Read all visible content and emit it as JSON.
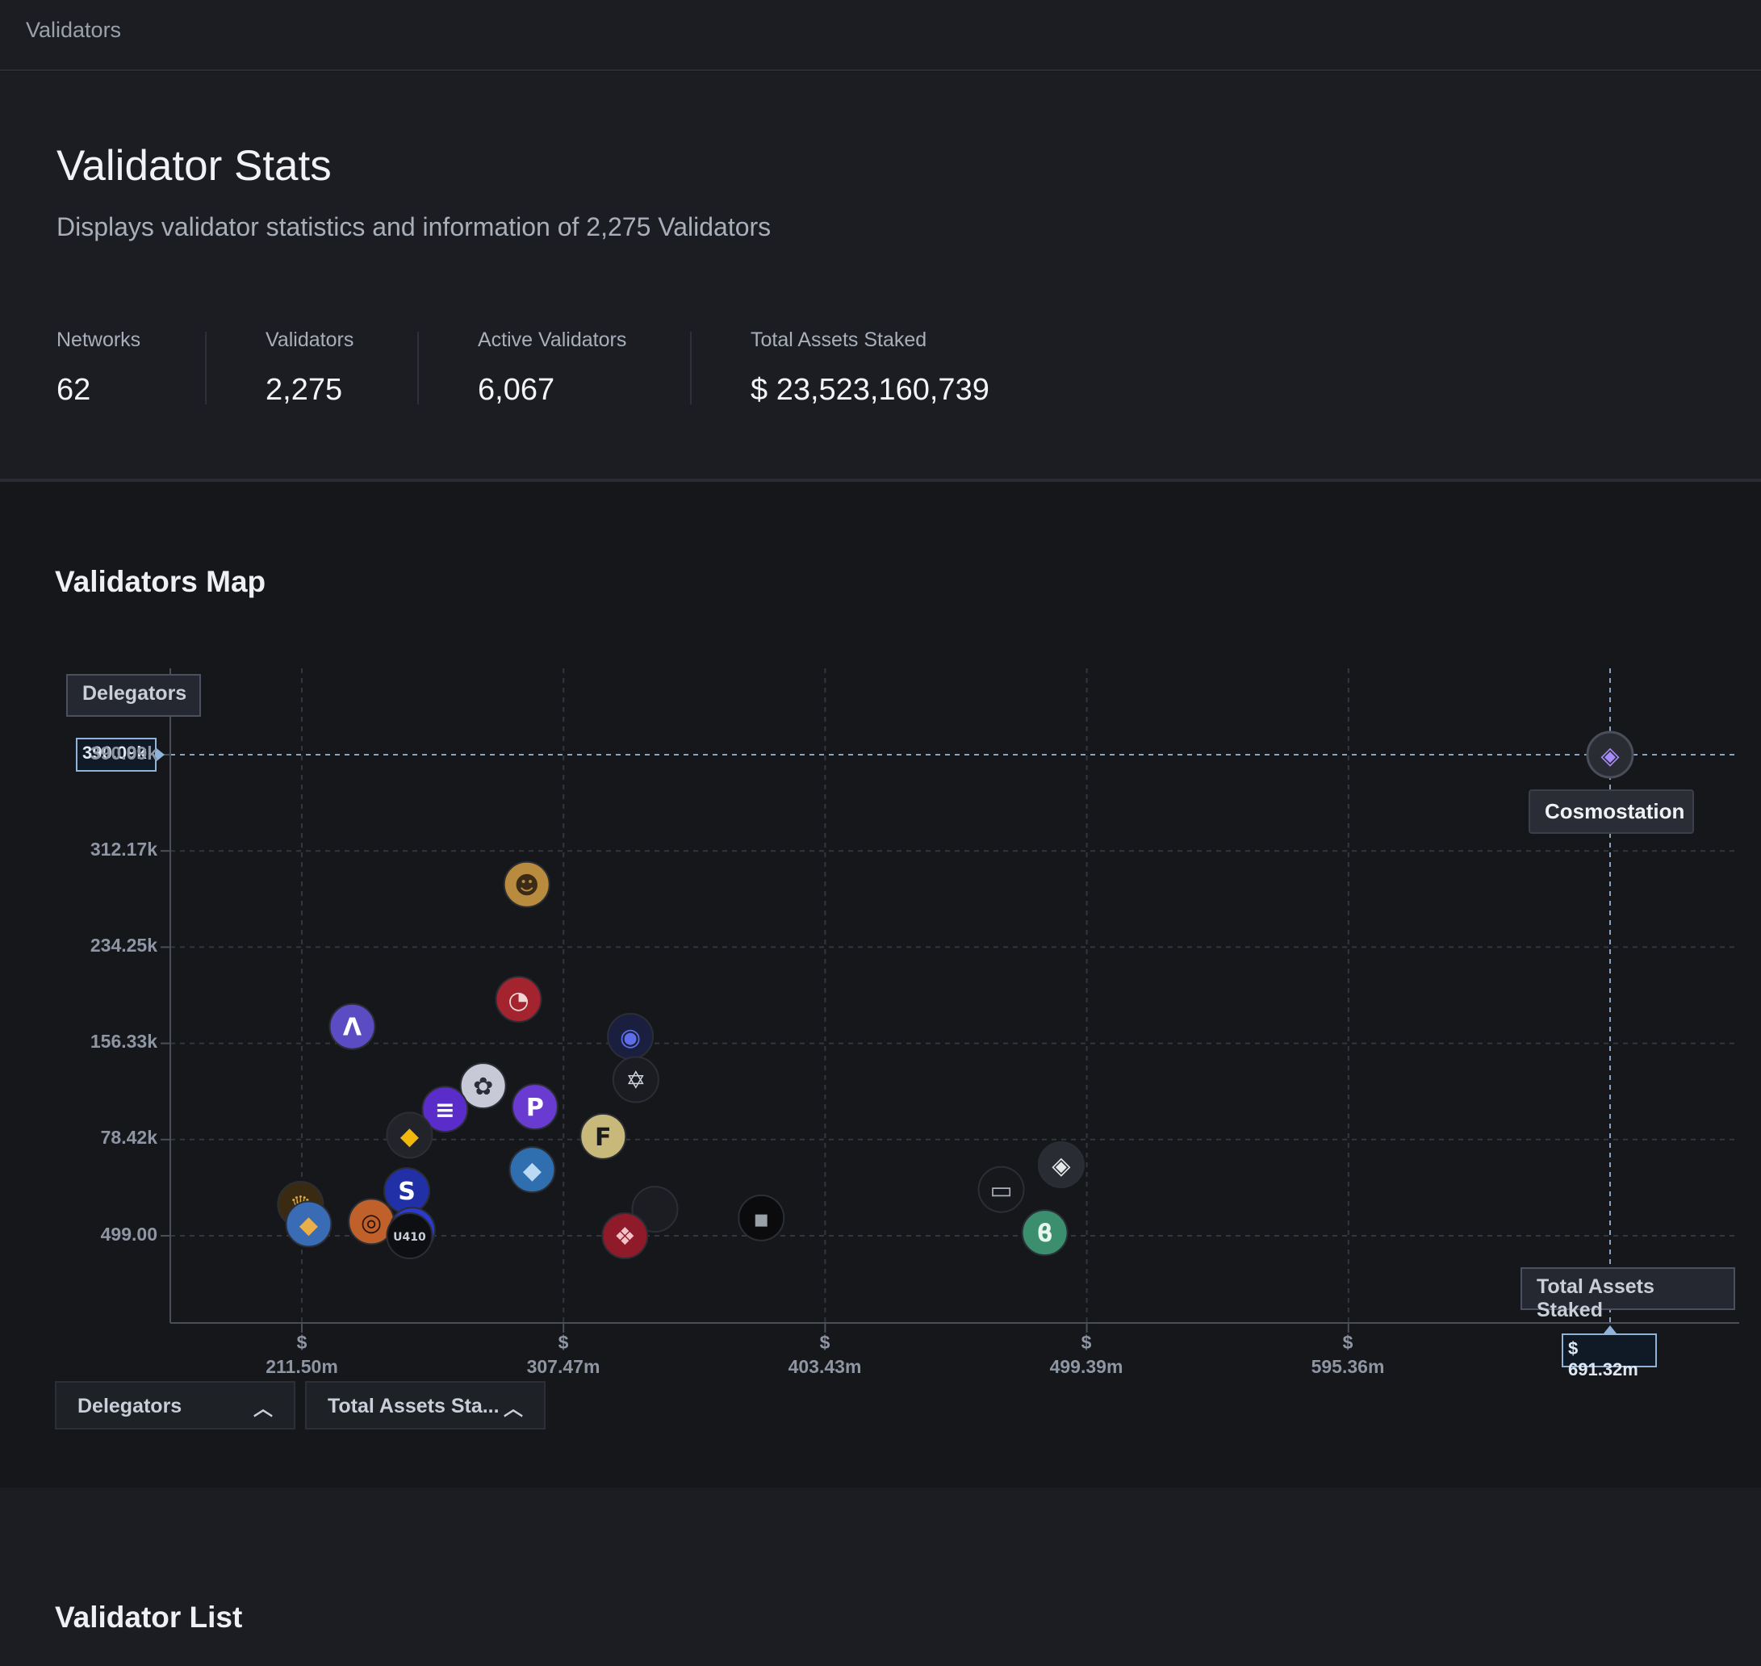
{
  "breadcrumb": "Validators",
  "header": {
    "title": "Validator Stats",
    "subtitle": "Displays validator statistics and information of 2,275 Validators"
  },
  "stats": [
    {
      "label": "Networks",
      "value": "62"
    },
    {
      "label": "Validators",
      "value": "2,275"
    },
    {
      "label": "Active Validators",
      "value": "6,067"
    },
    {
      "label": "Total Assets Staked",
      "value": "$ 23,523,160,739"
    }
  ],
  "map": {
    "title": "Validators Map",
    "y_axis_label": "Delegators",
    "x_axis_label": "Total Assets Staked",
    "y_ticks": [
      "390.09k",
      "312.17k",
      "234.25k",
      "156.33k",
      "78.42k",
      "499.00"
    ],
    "x_ticks": [
      {
        "top": "$",
        "bottom": "211.50m"
      },
      {
        "top": "$",
        "bottom": "307.47m"
      },
      {
        "top": "$",
        "bottom": "403.43m"
      },
      {
        "top": "$",
        "bottom": "499.39m"
      },
      {
        "top": "$",
        "bottom": "595.36m"
      }
    ],
    "hover": {
      "name": "Cosmostation",
      "y_value": "390.09k",
      "x_value": "$ 691.32m"
    },
    "dropdowns": [
      {
        "label": "Delegators",
        "icon": "chevron-up-icon"
      },
      {
        "label": "Total Assets Sta...",
        "icon": "chevron-up-icon"
      }
    ]
  },
  "list": {
    "title": "Validator List"
  },
  "chart_data": {
    "type": "scatter",
    "title": "Validators Map",
    "xlabel": "Total Assets Staked",
    "ylabel": "Delegators",
    "xlim": [
      163.5,
      720
    ],
    "ylim": [
      -70000,
      390090
    ],
    "points": [
      {
        "name": "Cosmostation",
        "x": 691.32,
        "y": 390090,
        "color": "#2a2c33",
        "mark": "◈",
        "fg": "#a78bfa"
      },
      {
        "x": 294,
        "y": 285000,
        "color": "#b98b3e",
        "mark": "☻",
        "fg": "#3a2a16"
      },
      {
        "x": 291,
        "y": 192000,
        "color": "#a3232e",
        "mark": "◔",
        "fg": "#f2d6d6"
      },
      {
        "x": 230,
        "y": 170000,
        "color": "#5b4cc4",
        "mark": "Λ",
        "fg": "#ffffff"
      },
      {
        "x": 332,
        "y": 162000,
        "color": "#1b1f3f",
        "mark": "◉",
        "fg": "#5d6ee8"
      },
      {
        "x": 278,
        "y": 122000,
        "color": "#c8c9d6",
        "mark": "✿",
        "fg": "#2b2d3a"
      },
      {
        "x": 334,
        "y": 127000,
        "color": "#1a1c21",
        "mark": "✡",
        "fg": "#d0d3d9"
      },
      {
        "x": 297,
        "y": 105000,
        "color": "#6a3bd1",
        "mark": "P",
        "fg": "#ffffff"
      },
      {
        "x": 264,
        "y": 103000,
        "color": "#5a2cc9",
        "mark": "≡",
        "fg": "#ffffff"
      },
      {
        "x": 251,
        "y": 82000,
        "color": "#222429",
        "mark": "◆",
        "fg": "#f0b90b"
      },
      {
        "x": 322,
        "y": 81000,
        "color": "#c8b97a",
        "mark": "F",
        "fg": "#1b1b1b"
      },
      {
        "x": 490,
        "y": 58000,
        "color": "#2a2c33",
        "mark": "◈",
        "fg": "#e6e8ec"
      },
      {
        "x": 296,
        "y": 54000,
        "color": "#2f6fb0",
        "mark": "◆",
        "fg": "#b9d9f5"
      },
      {
        "x": 250,
        "y": 37000,
        "color": "#2230a8",
        "mark": "S",
        "fg": "#ffffff"
      },
      {
        "x": 468,
        "y": 38000,
        "color": "#17181c",
        "mark": "▭",
        "fg": "#aab0bb"
      },
      {
        "x": 341,
        "y": 22000,
        "color": "#1b1d22",
        "mark": "",
        "fg": "#aab0bb"
      },
      {
        "x": 211,
        "y": 26000,
        "color": "#3b2a12",
        "mark": "♛",
        "fg": "#d9a848"
      },
      {
        "x": 380,
        "y": 15000,
        "color": "#0b0b0d",
        "mark": "▪",
        "fg": "#9aa0a8"
      },
      {
        "x": 237,
        "y": 12000,
        "color": "#c0612b",
        "mark": "◎",
        "fg": "#2a1205"
      },
      {
        "x": 214,
        "y": 10000,
        "color": "#3a6bb5",
        "mark": "◆",
        "fg": "#e8b04a"
      },
      {
        "x": 252,
        "y": 5000,
        "color": "#2b3bd0",
        "mark": "✦",
        "fg": "#ffffff"
      },
      {
        "x": 251,
        "y": 499,
        "color": "#0e0f13",
        "mark": "U410",
        "fg": "#c9ced8"
      },
      {
        "x": 484,
        "y": 3000,
        "color": "#3b8e6e",
        "mark": "ϐ",
        "fg": "#e9f6f0"
      },
      {
        "x": 330,
        "y": 499,
        "color": "#8f1a2a",
        "mark": "❖",
        "fg": "#f3c1c8"
      }
    ]
  }
}
